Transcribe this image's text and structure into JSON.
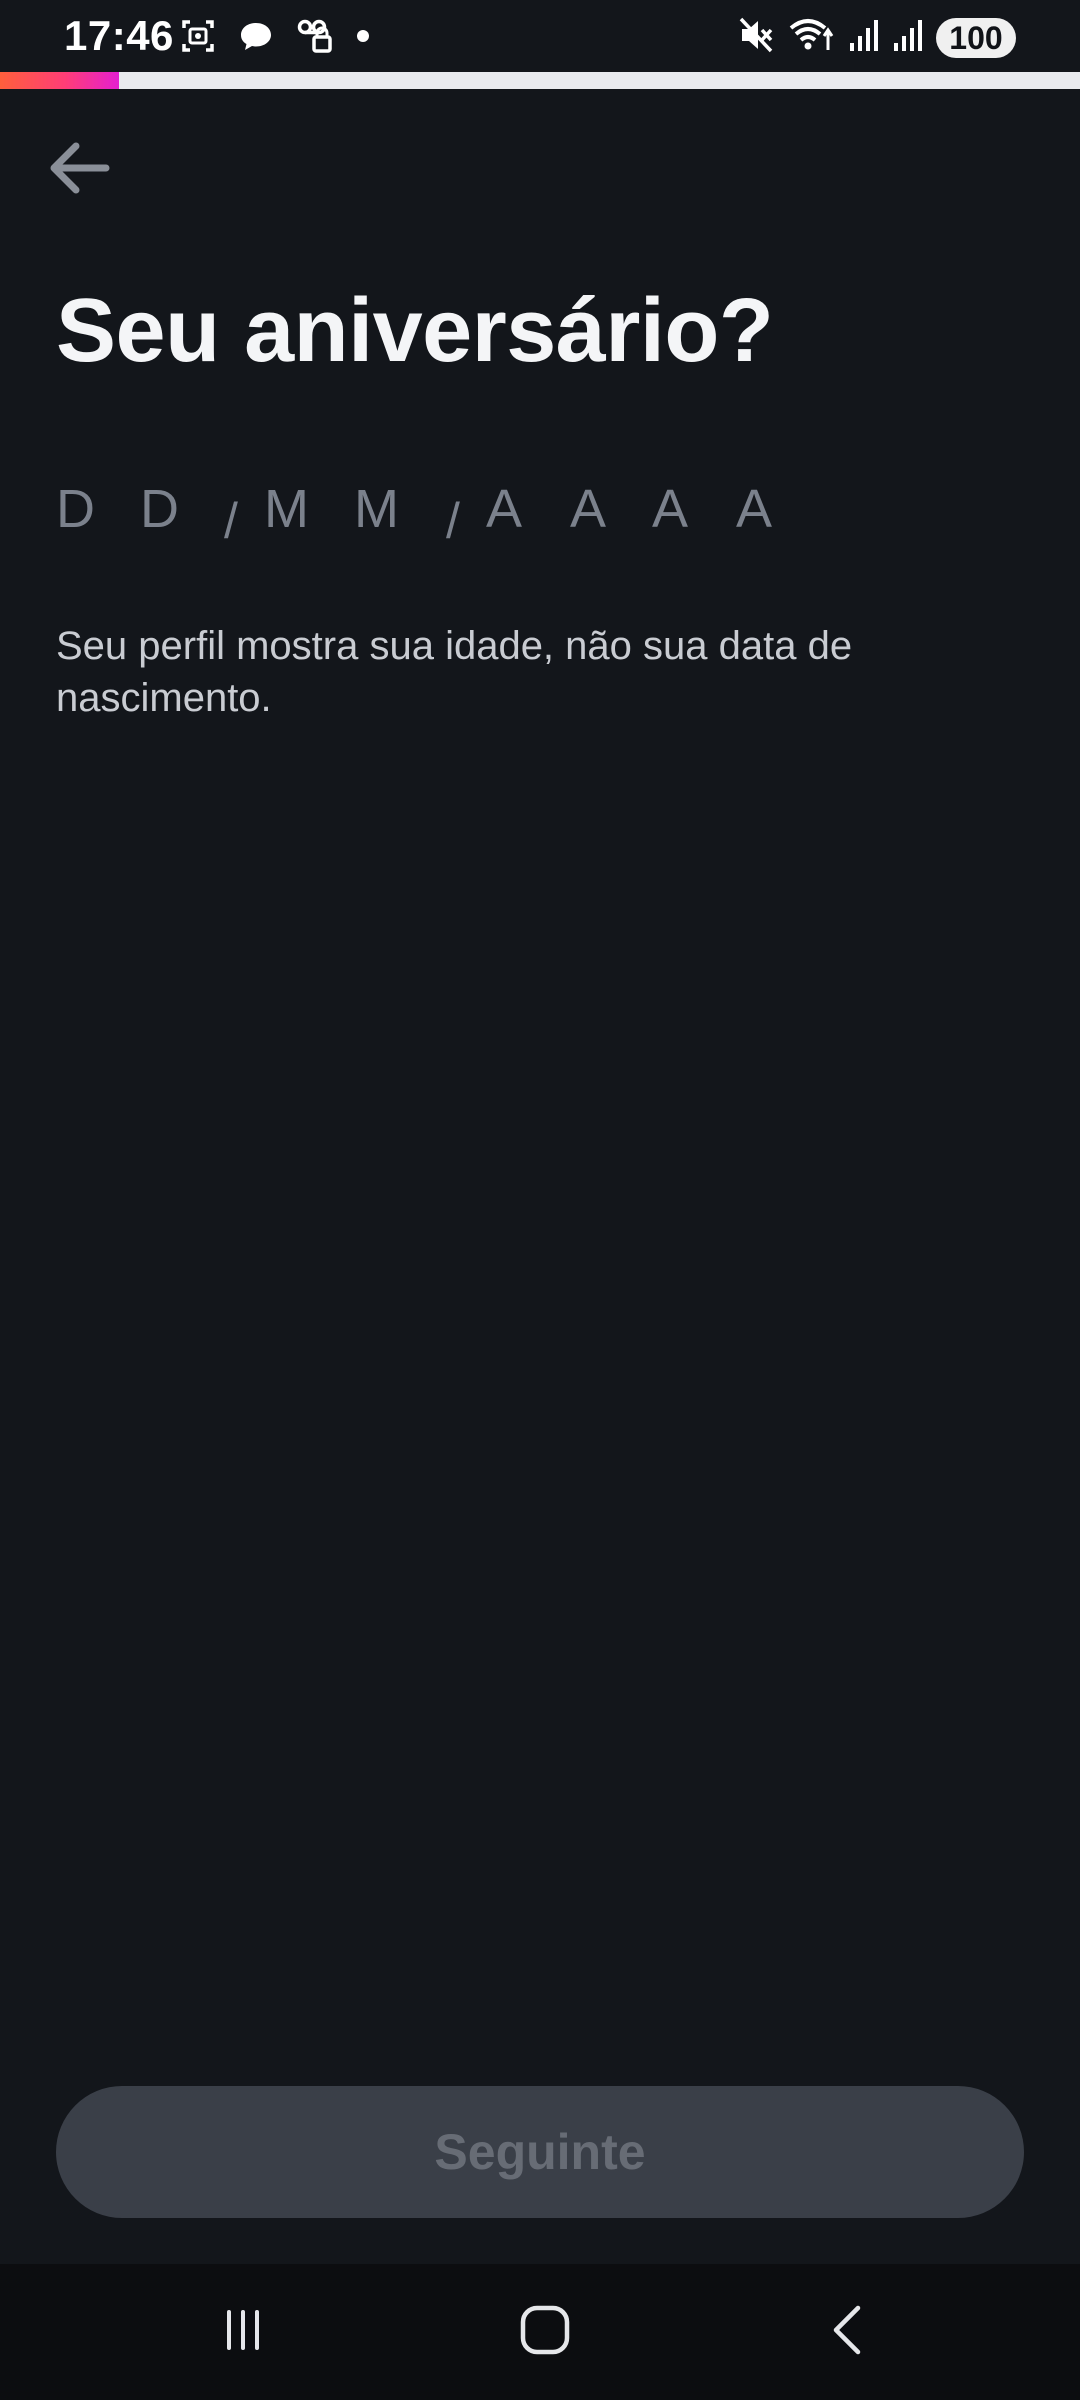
{
  "status_bar": {
    "time": "17:46",
    "battery": "100",
    "icons": [
      "screenshot-icon",
      "chat-bubble-icon",
      "voicemail-icon",
      "notification-dot-icon",
      "mute-icon",
      "wifi-icon",
      "signal-icon",
      "signal-icon"
    ]
  },
  "progress": {
    "fraction": 0.11,
    "colors": [
      "#ff5f3c",
      "#ff3d77",
      "#e41fd0"
    ]
  },
  "header": {
    "back_icon": "arrow-left-icon",
    "title": "Seu aniversário?"
  },
  "date_input": {
    "day_placeholder": [
      "D",
      "D"
    ],
    "month_placeholder": [
      "M",
      "M"
    ],
    "year_placeholder": [
      "A",
      "A",
      "A",
      "A"
    ],
    "separator": "/"
  },
  "helper_text": "Seu perfil mostra sua idade, não sua data de nascimento.",
  "next_button": {
    "label": "Seguinte",
    "enabled": false
  },
  "nav_bar": {
    "icons": [
      "recent-apps-icon",
      "home-icon",
      "back-icon"
    ]
  },
  "colors": {
    "background": "#13161b",
    "button_disabled": "#3a3f48",
    "placeholder": "#7b818c"
  }
}
